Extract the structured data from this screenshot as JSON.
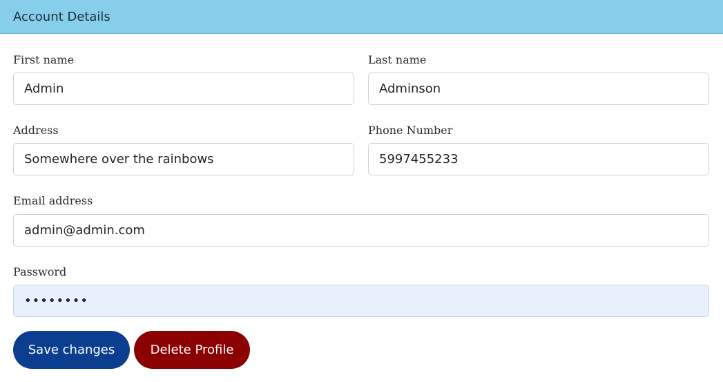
{
  "header": {
    "title": "Account Details"
  },
  "form": {
    "first_name": {
      "label": "First name",
      "value": "Admin"
    },
    "last_name": {
      "label": "Last name",
      "value": "Adminson"
    },
    "address": {
      "label": "Address",
      "value": "Somewhere over the rainbows"
    },
    "phone": {
      "label": "Phone Number",
      "value": "5997455233"
    },
    "email": {
      "label": "Email address",
      "value": "admin@admin.com"
    },
    "password": {
      "label": "Password",
      "value": "••••••••"
    }
  },
  "actions": {
    "save_label": "Save changes",
    "delete_label": "Delete Profile"
  },
  "colors": {
    "header_bg": "#87ceeb",
    "save_button": "#0b3e8f",
    "delete_button": "#8b0000",
    "autofill_bg": "#e8f0fe"
  }
}
